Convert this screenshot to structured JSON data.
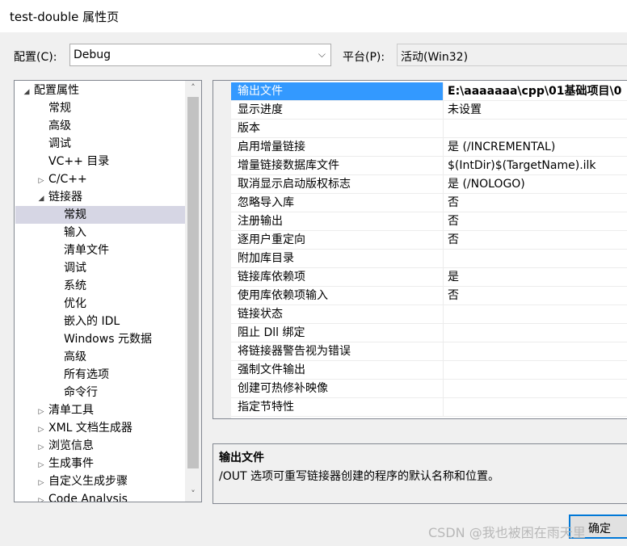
{
  "window": {
    "title": "test-double 属性页"
  },
  "config": {
    "label": "配置(C):",
    "value": "Debug"
  },
  "platform": {
    "label": "平台(P):",
    "value": "活动(Win32)"
  },
  "tree": [
    {
      "label": "配置属性",
      "level": 0,
      "toggle": "expanded"
    },
    {
      "label": "常规",
      "level": 1,
      "toggle": "none"
    },
    {
      "label": "高级",
      "level": 1,
      "toggle": "none"
    },
    {
      "label": "调试",
      "level": 1,
      "toggle": "none"
    },
    {
      "label": "VC++ 目录",
      "level": 1,
      "toggle": "none"
    },
    {
      "label": "C/C++",
      "level": 1,
      "toggle": "collapsed"
    },
    {
      "label": "链接器",
      "level": 1,
      "toggle": "expanded"
    },
    {
      "label": "常规",
      "level": 2,
      "toggle": "none",
      "selected": true
    },
    {
      "label": "输入",
      "level": 2,
      "toggle": "none"
    },
    {
      "label": "清单文件",
      "level": 2,
      "toggle": "none"
    },
    {
      "label": "调试",
      "level": 2,
      "toggle": "none"
    },
    {
      "label": "系统",
      "level": 2,
      "toggle": "none"
    },
    {
      "label": "优化",
      "level": 2,
      "toggle": "none"
    },
    {
      "label": "嵌入的 IDL",
      "level": 2,
      "toggle": "none"
    },
    {
      "label": "Windows 元数据",
      "level": 2,
      "toggle": "none"
    },
    {
      "label": "高级",
      "level": 2,
      "toggle": "none"
    },
    {
      "label": "所有选项",
      "level": 2,
      "toggle": "none"
    },
    {
      "label": "命令行",
      "level": 2,
      "toggle": "none"
    },
    {
      "label": "清单工具",
      "level": 1,
      "toggle": "collapsed"
    },
    {
      "label": "XML 文档生成器",
      "level": 1,
      "toggle": "collapsed"
    },
    {
      "label": "浏览信息",
      "level": 1,
      "toggle": "collapsed"
    },
    {
      "label": "生成事件",
      "level": 1,
      "toggle": "collapsed"
    },
    {
      "label": "自定义生成步骤",
      "level": 1,
      "toggle": "collapsed"
    },
    {
      "label": "Code Analysis",
      "level": 1,
      "toggle": "collapsed"
    }
  ],
  "properties": [
    {
      "name": "输出文件",
      "value": "E:\\aaaaaaa\\cpp\\01基础项目\\0",
      "selected": true
    },
    {
      "name": "显示进度",
      "value": "未设置"
    },
    {
      "name": "版本",
      "value": ""
    },
    {
      "name": "启用增量链接",
      "value": "是 (/INCREMENTAL)"
    },
    {
      "name": "增量链接数据库文件",
      "value": "$(IntDir)$(TargetName).ilk"
    },
    {
      "name": "取消显示启动版权标志",
      "value": "是 (/NOLOGO)"
    },
    {
      "name": "忽略导入库",
      "value": "否"
    },
    {
      "name": "注册输出",
      "value": "否"
    },
    {
      "name": "逐用户重定向",
      "value": "否"
    },
    {
      "name": "附加库目录",
      "value": ""
    },
    {
      "name": "链接库依赖项",
      "value": "是"
    },
    {
      "name": "使用库依赖项输入",
      "value": "否"
    },
    {
      "name": "链接状态",
      "value": ""
    },
    {
      "name": "阻止 Dll 绑定",
      "value": ""
    },
    {
      "name": "将链接器警告视为错误",
      "value": ""
    },
    {
      "name": "强制文件输出",
      "value": ""
    },
    {
      "name": "创建可热修补映像",
      "value": ""
    },
    {
      "name": "指定节特性",
      "value": ""
    }
  ],
  "description": {
    "title": "输出文件",
    "text": "/OUT 选项可重写链接器创建的程序的默认名称和位置。"
  },
  "buttons": {
    "ok": "确定"
  },
  "watermark": "CSDN @我也被困在雨天里"
}
